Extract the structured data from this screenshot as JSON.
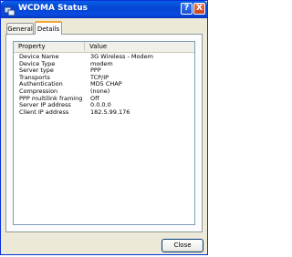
{
  "window": {
    "title": "WCDMA Status"
  },
  "titlebar": {
    "help_label": "?",
    "close_label": "X"
  },
  "tabs": [
    {
      "label": "General"
    },
    {
      "label": "Details"
    }
  ],
  "details": {
    "columns": [
      "Property",
      "Value"
    ],
    "rows": [
      [
        "Device Name",
        "3G Wireless - Modem"
      ],
      [
        "Device Type",
        "modem"
      ],
      [
        "Server type",
        "PPP"
      ],
      [
        "Transports",
        "TCP/IP"
      ],
      [
        "Authentication",
        "MD5 CHAP"
      ],
      [
        "Compression",
        "(none)"
      ],
      [
        "PPP multilink framing",
        "Off"
      ],
      [
        "Server IP address",
        "0.0.0.0"
      ],
      [
        "Client IP address",
        "182.5.99.176"
      ]
    ]
  },
  "footer": {
    "close_label": "Close"
  }
}
